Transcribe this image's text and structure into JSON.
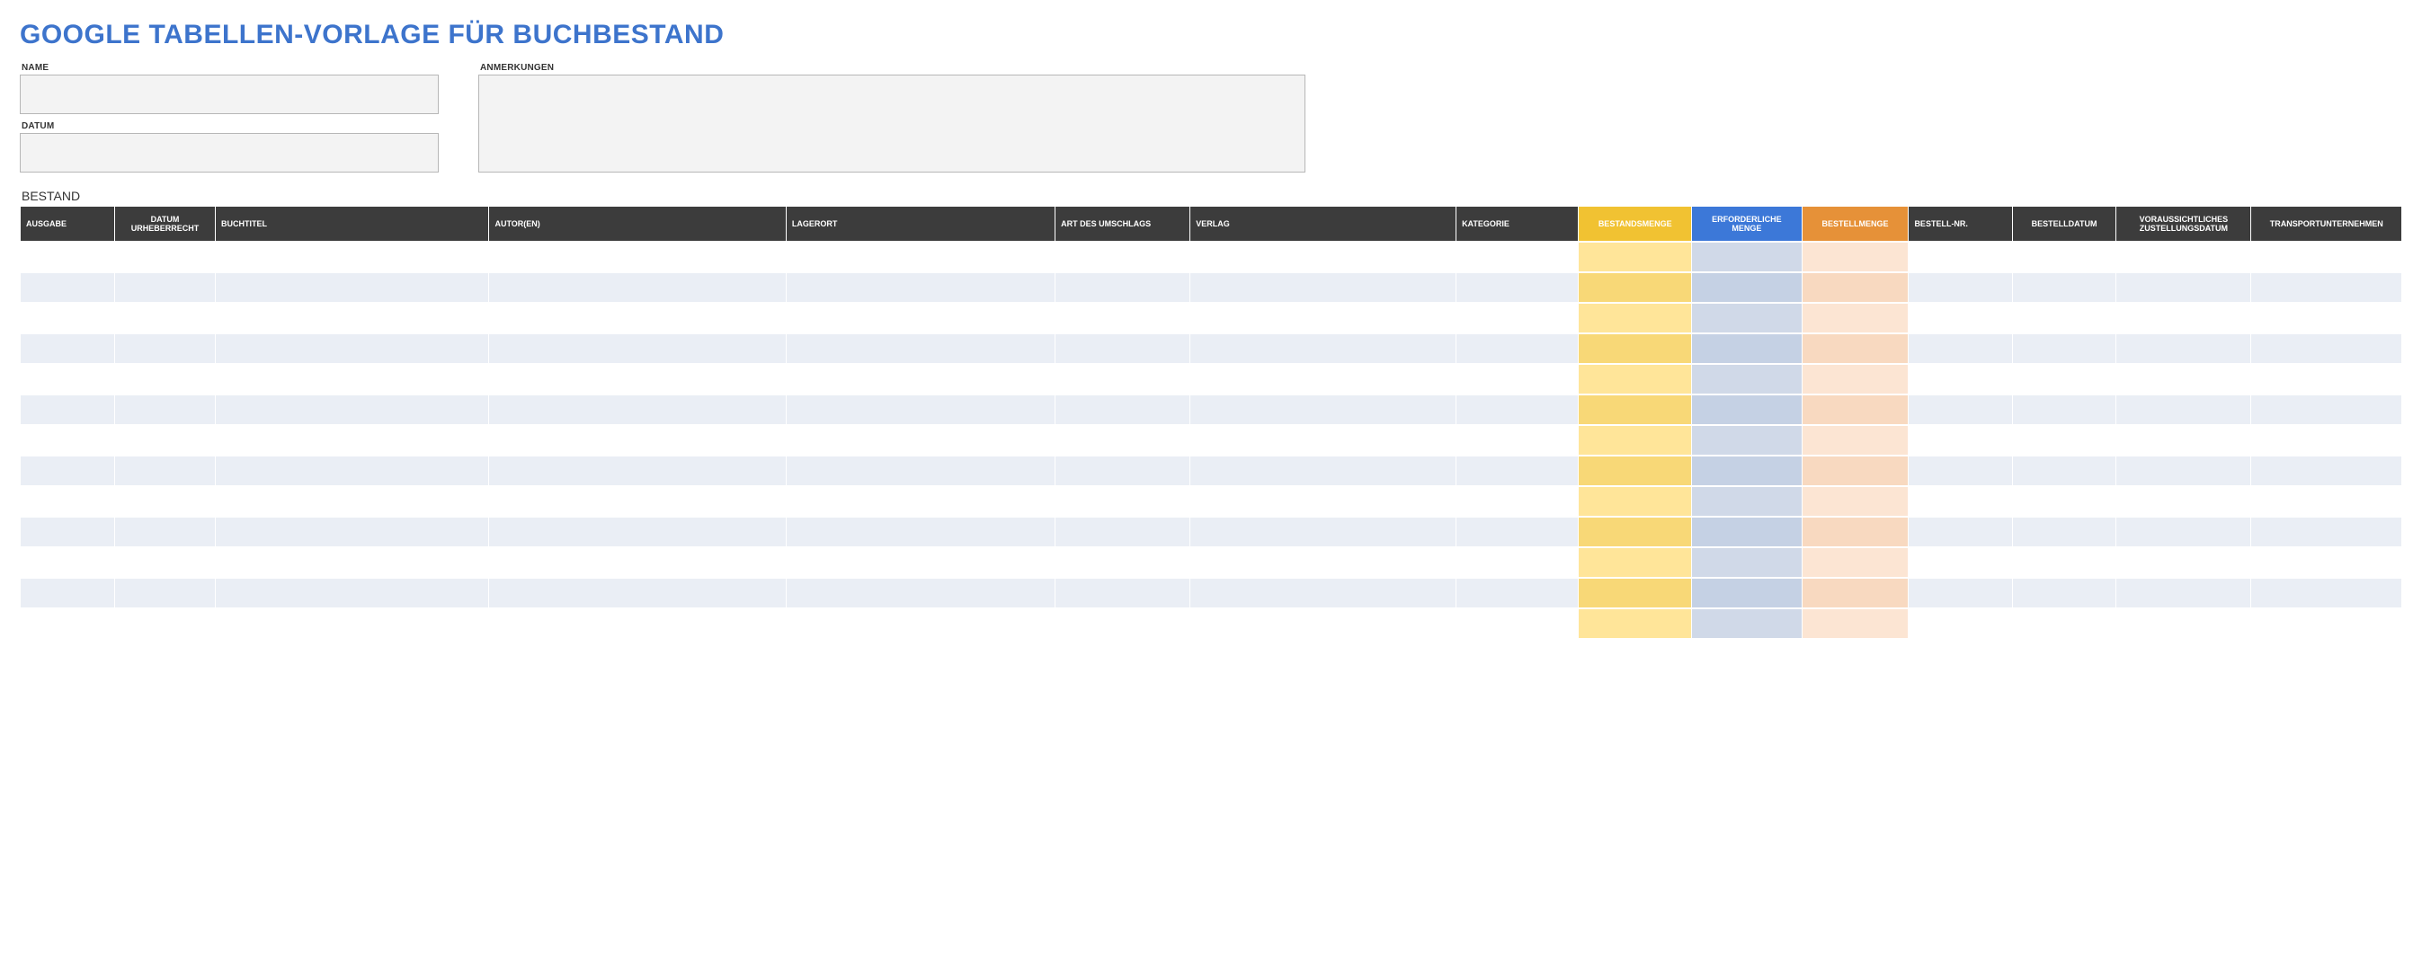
{
  "title": "GOOGLE TABELLEN-VORLAGE FÜR BUCHBESTAND",
  "fields": {
    "name_label": "NAME",
    "name_value": "",
    "datum_label": "DATUM",
    "datum_value": "",
    "anmerkungen_label": "ANMERKUNGEN",
    "anmerkungen_value": ""
  },
  "section_label": "BESTAND",
  "columns": [
    {
      "label": "AUSGABE",
      "width": 60,
      "align": "left",
      "hclass": "",
      "cclass": ""
    },
    {
      "label": "DATUM URHEBERRECHT",
      "width": 64,
      "align": "center",
      "hclass": "",
      "cclass": ""
    },
    {
      "label": "BUCHTITEL",
      "width": 175,
      "align": "left",
      "hclass": "",
      "cclass": ""
    },
    {
      "label": "AUTOR(EN)",
      "width": 190,
      "align": "left",
      "hclass": "",
      "cclass": ""
    },
    {
      "label": "LAGERORT",
      "width": 172,
      "align": "left",
      "hclass": "",
      "cclass": ""
    },
    {
      "label": "ART DES UMSCHLAGS",
      "width": 86,
      "align": "left",
      "hclass": "",
      "cclass": ""
    },
    {
      "label": "VERLAG",
      "width": 170,
      "align": "left",
      "hclass": "",
      "cclass": ""
    },
    {
      "label": "KATEGORIE",
      "width": 78,
      "align": "left",
      "hclass": "",
      "cclass": ""
    },
    {
      "label": "BESTANDSMENGE",
      "width": 72,
      "align": "center",
      "hclass": "h-yellow",
      "cclass": "c-yellow"
    },
    {
      "label": "ERFORDERLICHE MENGE",
      "width": 70,
      "align": "center",
      "hclass": "h-blue",
      "cclass": "c-blue"
    },
    {
      "label": "BESTELLMENGE",
      "width": 68,
      "align": "center",
      "hclass": "h-orange",
      "cclass": "c-orange"
    },
    {
      "label": "BESTELL-NR.",
      "width": 66,
      "align": "left",
      "hclass": "",
      "cclass": ""
    },
    {
      "label": "BESTELLDATUM",
      "width": 66,
      "align": "center",
      "hclass": "",
      "cclass": ""
    },
    {
      "label": "VORAUSSICHTLICHES ZUSTELLUNGSDATUM",
      "width": 86,
      "align": "center",
      "hclass": "",
      "cclass": ""
    },
    {
      "label": "TRANSPORTUNTERNEHMEN",
      "width": 96,
      "align": "center",
      "hclass": "",
      "cclass": ""
    }
  ],
  "rows": [
    [
      "",
      "",
      "",
      "",
      "",
      "",
      "",
      "",
      "",
      "",
      "",
      "",
      "",
      "",
      ""
    ],
    [
      "",
      "",
      "",
      "",
      "",
      "",
      "",
      "",
      "",
      "",
      "",
      "",
      "",
      "",
      ""
    ],
    [
      "",
      "",
      "",
      "",
      "",
      "",
      "",
      "",
      "",
      "",
      "",
      "",
      "",
      "",
      ""
    ],
    [
      "",
      "",
      "",
      "",
      "",
      "",
      "",
      "",
      "",
      "",
      "",
      "",
      "",
      "",
      ""
    ],
    [
      "",
      "",
      "",
      "",
      "",
      "",
      "",
      "",
      "",
      "",
      "",
      "",
      "",
      "",
      ""
    ],
    [
      "",
      "",
      "",
      "",
      "",
      "",
      "",
      "",
      "",
      "",
      "",
      "",
      "",
      "",
      ""
    ],
    [
      "",
      "",
      "",
      "",
      "",
      "",
      "",
      "",
      "",
      "",
      "",
      "",
      "",
      "",
      ""
    ],
    [
      "",
      "",
      "",
      "",
      "",
      "",
      "",
      "",
      "",
      "",
      "",
      "",
      "",
      "",
      ""
    ],
    [
      "",
      "",
      "",
      "",
      "",
      "",
      "",
      "",
      "",
      "",
      "",
      "",
      "",
      "",
      ""
    ],
    [
      "",
      "",
      "",
      "",
      "",
      "",
      "",
      "",
      "",
      "",
      "",
      "",
      "",
      "",
      ""
    ],
    [
      "",
      "",
      "",
      "",
      "",
      "",
      "",
      "",
      "",
      "",
      "",
      "",
      "",
      "",
      ""
    ],
    [
      "",
      "",
      "",
      "",
      "",
      "",
      "",
      "",
      "",
      "",
      "",
      "",
      "",
      "",
      ""
    ],
    [
      "",
      "",
      "",
      "",
      "",
      "",
      "",
      "",
      "",
      "",
      "",
      "",
      "",
      "",
      ""
    ]
  ]
}
